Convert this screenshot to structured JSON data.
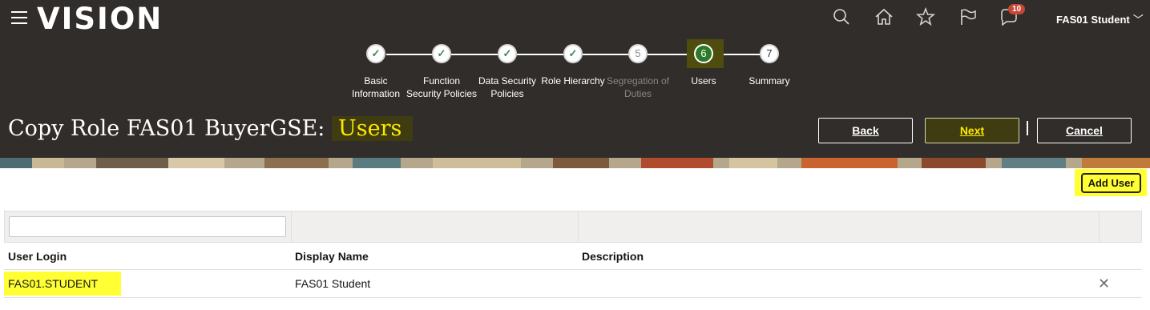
{
  "header": {
    "logo": "VISION",
    "notification_count": "10",
    "user_name": "FAS01 Student",
    "icons": [
      "search-icon",
      "home-icon",
      "favorites-star-icon",
      "flag-icon",
      "notifications-icon",
      "hamburger-menu-icon"
    ]
  },
  "train": {
    "steps": [
      {
        "number": "✓",
        "label1": "Basic",
        "label2": "Information",
        "state": "done"
      },
      {
        "number": "✓",
        "label1": "Function",
        "label2": "Security Policies",
        "state": "done"
      },
      {
        "number": "✓",
        "label1": "Data Security",
        "label2": "Policies",
        "state": "done"
      },
      {
        "number": "✓",
        "label1": "Role Hierarchy",
        "label2": "",
        "state": "done"
      },
      {
        "number": "5",
        "label1": "Segregation of",
        "label2": "Duties",
        "state": "disabled"
      },
      {
        "number": "6",
        "label1": "Users",
        "label2": "",
        "state": "current"
      },
      {
        "number": "7",
        "label1": "Summary",
        "label2": "",
        "state": "pending"
      }
    ]
  },
  "page": {
    "title_prefix": "Copy Role FAS01 BuyerGSE:",
    "title_highlight": "Users"
  },
  "buttons": {
    "back": "Back",
    "next": "Next",
    "cancel": "Cancel",
    "add_user": "Add User"
  },
  "table": {
    "columns": [
      "User Login",
      "Display Name",
      "Description"
    ],
    "rows": [
      {
        "user_login": "FAS01.STUDENT",
        "display_name": "FAS01 Student",
        "description": ""
      }
    ]
  },
  "colors": {
    "header_bg": "#312d2a",
    "highlight_yellow": "#ffff33",
    "current_step_green": "#2b7a28",
    "badge_red": "#c74634"
  }
}
